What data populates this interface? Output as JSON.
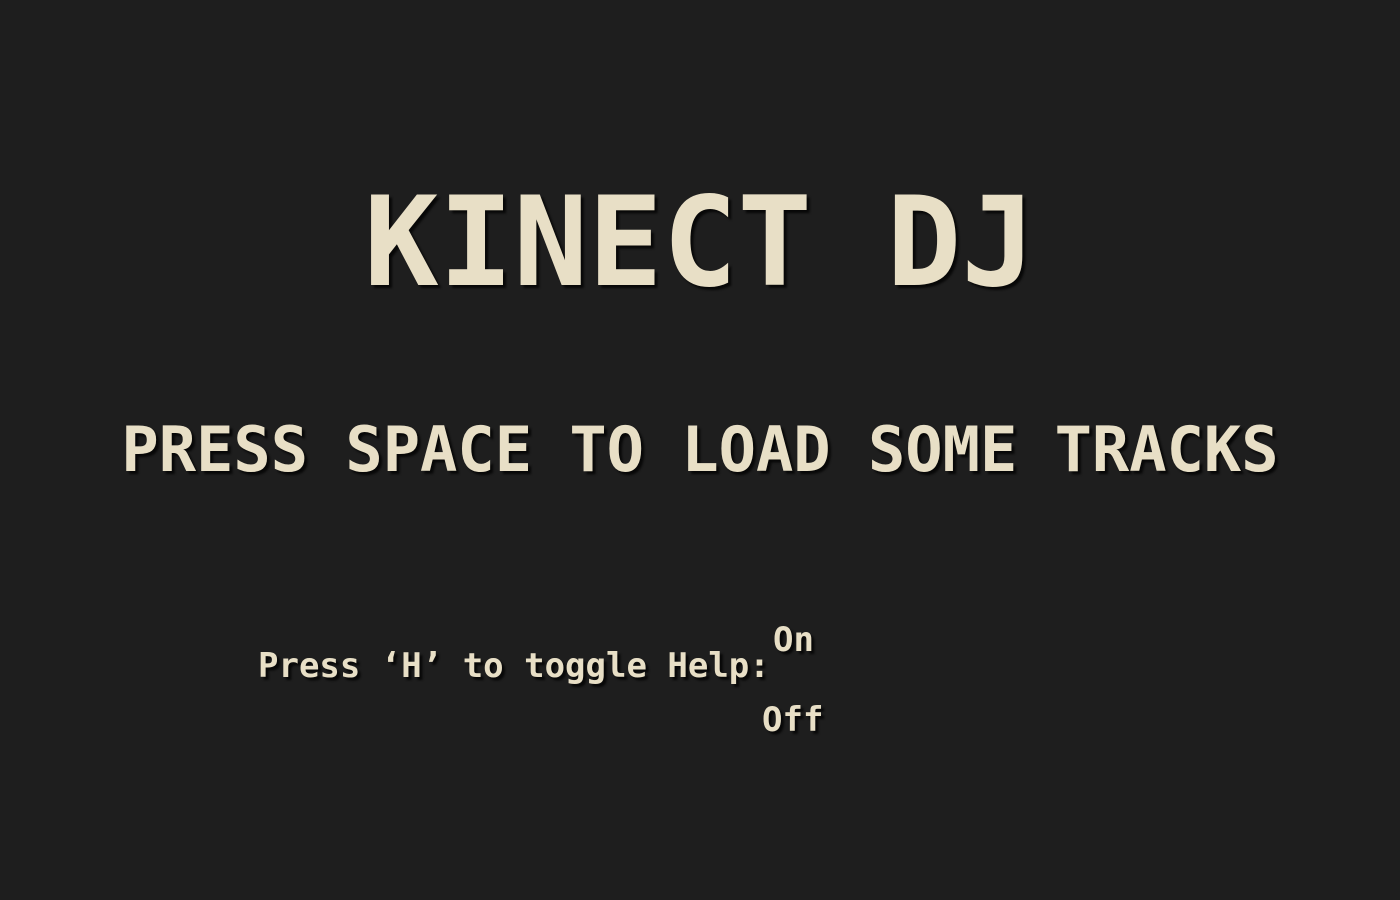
{
  "app": {
    "title": "KINECT DJ"
  },
  "main": {
    "prompt": "PRESS SPACE TO LOAD SOME TRACKS"
  },
  "help": {
    "label": "Press ‘H’ to toggle Help:",
    "options": [
      "On",
      "Off"
    ]
  },
  "colors": {
    "background": "#1e1e1e",
    "text": "#e8dfc6"
  }
}
